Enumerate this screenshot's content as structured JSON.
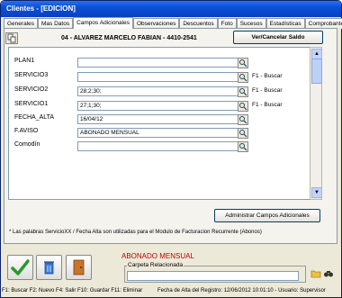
{
  "window": {
    "title": "Clientes - [EDICION]"
  },
  "tabs": [
    "Generales",
    "Mas Datos",
    "Campos Adicionales",
    "Observaciones",
    "Descuentos",
    "Foto",
    "Sucesos",
    "Estadísticas",
    "Comprobantes"
  ],
  "header": {
    "client": "04 - ALVAREZ MARCELO FABIAN - 4410-2541",
    "ver_saldo": "Ver/Cancelar Saldo"
  },
  "fields": [
    {
      "label": "PLAN1",
      "value": "",
      "hint": ""
    },
    {
      "label": "SERVICIO3",
      "value": "",
      "hint": "F1 - Buscar"
    },
    {
      "label": "SERVICIO2",
      "value": "28;2;30;",
      "hint": "F1 - Buscar"
    },
    {
      "label": "SERVICIO1",
      "value": "27;1;30;",
      "hint": "F1 - Buscar"
    },
    {
      "label": "FECHA_ALTA",
      "value": "16/04/12",
      "hint": ""
    },
    {
      "label": "F.AVISO",
      "value": "ABONADO MENSUAL",
      "hint": ""
    },
    {
      "label": "Comodín",
      "value": "",
      "hint": ""
    }
  ],
  "admin_button": "Administrar Campos Adicionales",
  "note": "* Las palabras ServicioXX / Fecha Alta son utilizadas para el Modulo de Facturacion Recurrente (Abonos)",
  "abono_label": "ABONADO MENSUAL",
  "carpeta": {
    "label": "Carpeta Relacionada",
    "value": ""
  },
  "status": {
    "shortcuts": "F1: Buscar  F2: Nuevo  F4: Salir  F10: Guardar  F11: Eliminar",
    "info": "Fecha de Alta del Registro: 12/06/2012 10:01:10 - Usuario: Supervisor"
  },
  "colors": {
    "title_bar": "#0a4fd8",
    "abono_text": "#c00000",
    "panel_bg": "#ece9d8"
  }
}
